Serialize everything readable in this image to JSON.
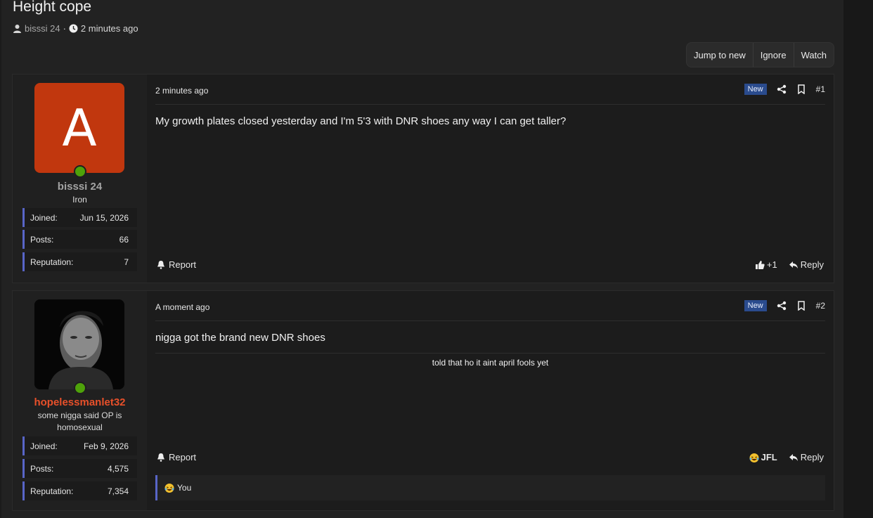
{
  "thread": {
    "title": "Height cope",
    "author": "bisssi 24",
    "separator": "·",
    "time": "2 minutes ago",
    "buttons": {
      "jump": "Jump to new",
      "ignore": "Ignore",
      "watch": "Watch"
    }
  },
  "posts": [
    {
      "avatar_letter": "A",
      "avatar_color": "#c1370e",
      "username": "bisssi 24",
      "username_color": "#a3a3a3",
      "usertitle": "Iron",
      "stats": {
        "joined_label": "Joined:",
        "joined": "Jun 15, 2026",
        "posts_label": "Posts:",
        "posts": "66",
        "rep_label": "Reputation:",
        "rep": "7"
      },
      "date": "2 minutes ago",
      "badge": "New",
      "number": "#1",
      "body": "My growth plates closed yesterday and I'm 5'3 with DNR shoes any way I can get taller?",
      "report": "Report",
      "reaction": "+1",
      "reply": "Reply"
    },
    {
      "username": "hopelessmanlet32",
      "username_color": "#e8502a",
      "usertitle": "some nigga said OP is homosexual",
      "stats": {
        "joined_label": "Joined:",
        "joined": "Feb 9, 2026",
        "posts_label": "Posts:",
        "posts": "4,575",
        "rep_label": "Reputation:",
        "rep": "7,354"
      },
      "date": "A moment ago",
      "badge": "New",
      "number": "#2",
      "body": "nigga got the brand new DNR shoes",
      "signature": "told that ho it aint april fools yet",
      "report": "Report",
      "reaction": "JFL",
      "reply": "Reply",
      "reaction_user": "You"
    }
  ],
  "colors": {
    "accent": "#5865c7",
    "online": "#4ea20a",
    "badge": "#2a4b8d"
  },
  "icons": [
    "user-icon",
    "clock-icon",
    "share-icon",
    "bookmark-icon",
    "bell-icon",
    "thumbs-up-icon",
    "reply-icon",
    "laughing-emoji-icon"
  ]
}
